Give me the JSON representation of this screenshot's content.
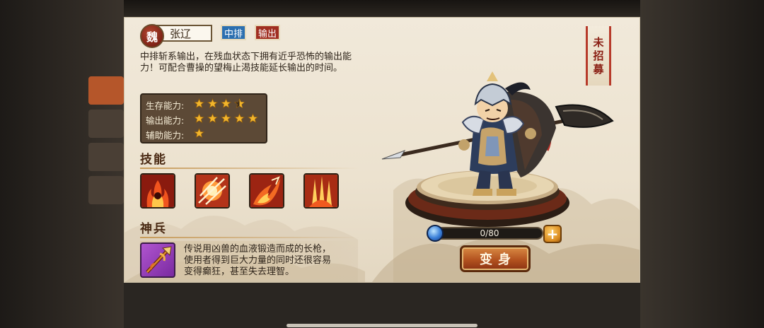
{
  "hero": {
    "kingdom": "魏",
    "name": "张辽",
    "tags": [
      "中排",
      "输出"
    ],
    "description": "中排斩系输出，在残血状态下拥有近乎恐怖的输出能力！可配合曹操的望梅止渴技能延长输出的时间。",
    "recruit_status": [
      "未",
      "招",
      "募"
    ]
  },
  "abilities": [
    {
      "label": "生存能力:",
      "rating": 3.5,
      "max": 5
    },
    {
      "label": "输出能力:",
      "rating": 5,
      "max": 5
    },
    {
      "label": "辅助能力:",
      "rating": 1,
      "max": 5
    }
  ],
  "skills": {
    "title": "技能",
    "icons": [
      "flame-warrior-icon",
      "slash-burst-icon",
      "fire-strike-icon",
      "flame-claw-icon"
    ]
  },
  "divine_weapon": {
    "title": "神兵",
    "icon": "halberd-icon",
    "description": "传说用凶兽的血液锻造而成的长枪，使用者得到巨大力量的同时还很容易变得癫狂，甚至失去理智。"
  },
  "progress": {
    "value": 0,
    "max": 80,
    "text": "0/80"
  },
  "buttons": {
    "plus": "+",
    "transform": "变身"
  },
  "colors": {
    "panel": "#ece2cf",
    "accent_red": "#a02e20",
    "accent_blue": "#2b6fb0",
    "star": "#f2b52b"
  }
}
